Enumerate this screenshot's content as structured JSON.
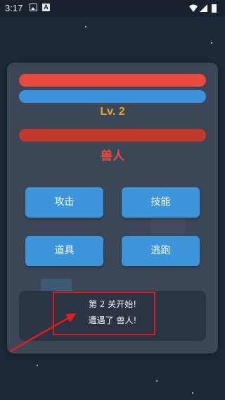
{
  "status_bar": {
    "time": "3:17",
    "notification_icons": [
      "image-icon",
      "a-icon"
    ],
    "right_icons": [
      "wifi-icon",
      "signal-icon",
      "battery-icon"
    ]
  },
  "player": {
    "level": "Lv. 2",
    "hp_fill": 1.0,
    "mp_fill": 1.0,
    "hp_color": "#e84a3f",
    "mp_color": "#3a93dc"
  },
  "enemy": {
    "name": "兽人",
    "hp_fill": 1.0,
    "hp_color": "#c0392b"
  },
  "actions": {
    "attack": "攻击",
    "skill": "技能",
    "item": "道具",
    "flee": "逃跑"
  },
  "log": {
    "lines": [
      "第 2 关开始!",
      "遭遇了 兽人!"
    ]
  },
  "colors": {
    "background": "#1d2838",
    "panel": "#3b4656",
    "button": "#3d95dc",
    "level_text": "#f0a32b",
    "annotation": "#e01c1c"
  }
}
